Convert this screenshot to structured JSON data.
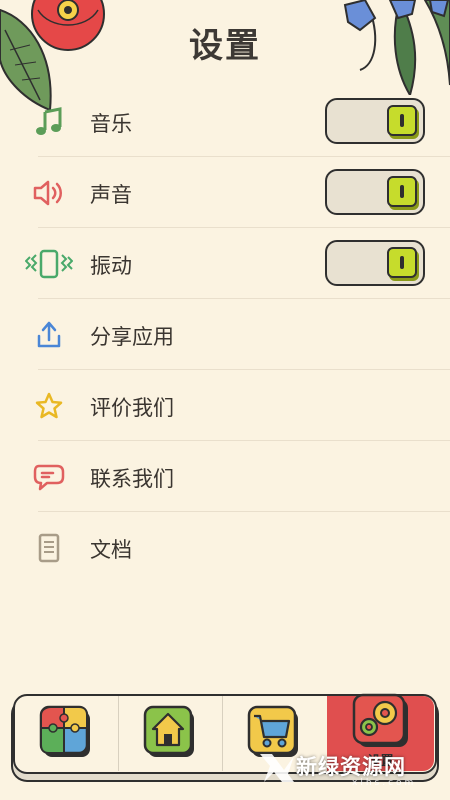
{
  "page": {
    "title": "设置"
  },
  "settings": [
    {
      "label": "音乐",
      "icon": "music-note-icon",
      "toggle": true,
      "on": true
    },
    {
      "label": "声音",
      "icon": "speaker-icon",
      "toggle": true,
      "on": true
    },
    {
      "label": "振动",
      "icon": "vibrate-icon",
      "toggle": true,
      "on": true
    },
    {
      "label": "分享应用",
      "icon": "share-icon",
      "toggle": false
    },
    {
      "label": "评价我们",
      "icon": "star-icon",
      "toggle": false
    },
    {
      "label": "联系我们",
      "icon": "chat-icon",
      "toggle": false
    },
    {
      "label": "文档",
      "icon": "document-icon",
      "toggle": false
    }
  ],
  "tabbar": {
    "tabs": [
      {
        "icon": "puzzle-icon"
      },
      {
        "icon": "home-icon"
      },
      {
        "icon": "cart-icon"
      },
      {
        "icon": "gears-icon",
        "label": "设置",
        "active": true
      }
    ]
  },
  "watermark": {
    "text": "新绿资源网",
    "sub": "xlhs.com"
  },
  "colors": {
    "background": "#fbf3e1",
    "toggle_knob": "#c6dc2c",
    "active_tab": "#e04f4f"
  }
}
